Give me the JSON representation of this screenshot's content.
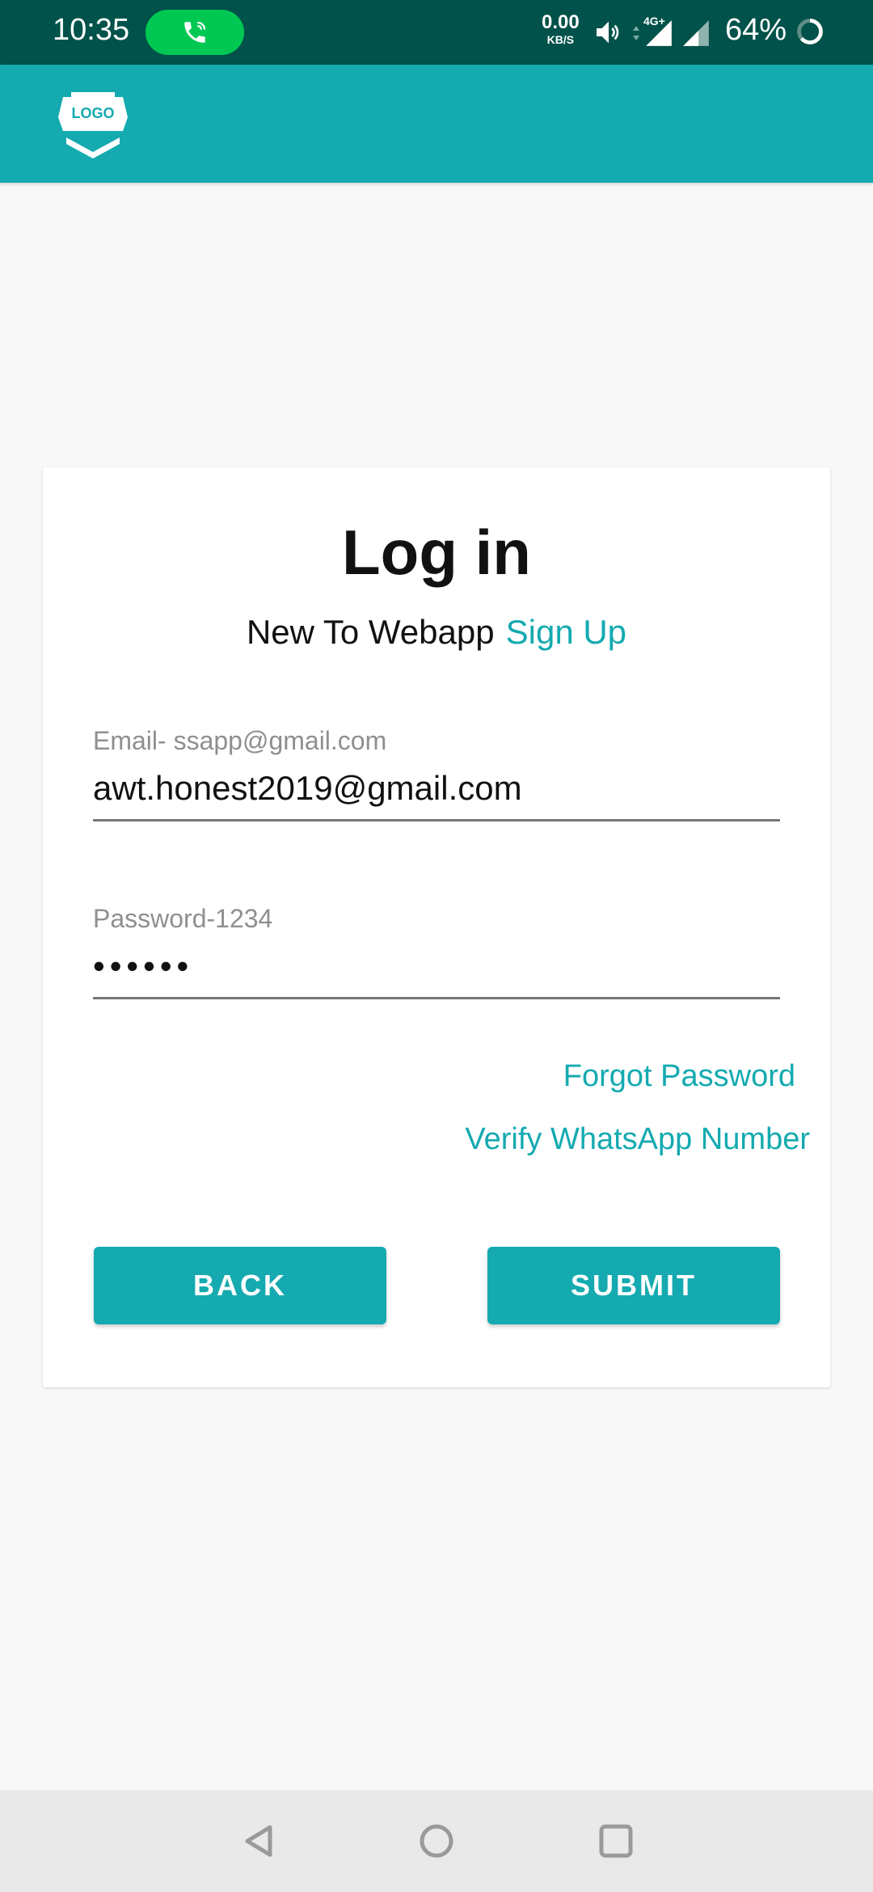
{
  "status_bar": {
    "time": "10:35",
    "network_speed_value": "0.00",
    "network_speed_unit": "KB/S",
    "network_type": "4G+",
    "battery": "64%",
    "icons": [
      "call-icon",
      "volume-icon",
      "signal-icon",
      "signal-icon-2",
      "battery-icon"
    ]
  },
  "app_bar": {
    "logo_text": "LOGO"
  },
  "login": {
    "title": "Log in",
    "signup_prompt": "New To Webapp",
    "signup_link": "Sign Up",
    "email": {
      "label": "Email- ssapp@gmail.com",
      "value": "awt.honest2019@gmail.com"
    },
    "password": {
      "label": "Password-1234",
      "value_masked": "••••••"
    },
    "forgot_password": "Forgot Password",
    "verify_whatsapp": "Verify WhatsApp Number",
    "back_button": "BACK",
    "submit_button": "SUBMIT"
  },
  "colors": {
    "status_bar": "#00524a",
    "accent": "#14aab0",
    "call_pill": "#00c853",
    "background": "#f8f8f8"
  }
}
